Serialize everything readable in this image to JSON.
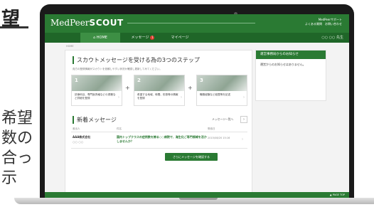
{
  "page": {
    "left_fragments": {
      "title": "望",
      "lines": [
        "希望",
        "数の",
        "合っ",
        "示"
      ]
    }
  },
  "app": {
    "logo_prefix": "MedPeer",
    "logo_suffix": "SCOUT",
    "user_name": "MedPeerサポート",
    "user_links": "よくある質問　お問い合わせ",
    "nav": {
      "home": "HOME",
      "messages": "メッセージ",
      "messages_badge": "1",
      "mypage": "マイページ",
      "right": "○○ ○○ 先生"
    },
    "breadcrumb": "HOME",
    "steps_section": {
      "title": "スカウトメッセージを受ける為の3つのステップ",
      "description": "貴方の登録情報がスカウトを依頼しやすい状況か確認し更新してみてください。",
      "steps": [
        {
          "num": "1",
          "text": "診療科目、専門医資格などの書籍など詳細を登録"
        },
        {
          "num": "2",
          "text": "希望する地域、時間、形態等の情報を登録"
        },
        {
          "num": "3",
          "text": "職務経験など経歴等を記述"
        }
      ]
    },
    "news_section": {
      "title": "新着メッセージ",
      "view_all": "メッセージ一覧へ",
      "view_all_icon": "chevron-right-icon",
      "headers": {
        "from": "差出人",
        "subject": "件名",
        "date": "受信日"
      },
      "rows": [
        {
          "from": "AAA株式会社",
          "from_sub": "○○ ○○",
          "subject": "国内トップクラスの症例数を誇る○○病院で、海生化ご専門領域を活かしませんか？",
          "date": "2015/08/20 15:16"
        }
      ],
      "more_button": "さらにメッセージを確認する"
    },
    "sidebar": {
      "title": "運営事務局からのお知らせ",
      "body": "運営からのお知らせはありません。"
    },
    "footer": {
      "pagetop": "▲ PAGE TOP"
    }
  },
  "colors": {
    "brand_green": "#2a7a33",
    "nav_green": "#1f6628",
    "badge_red": "#e03a2e"
  }
}
